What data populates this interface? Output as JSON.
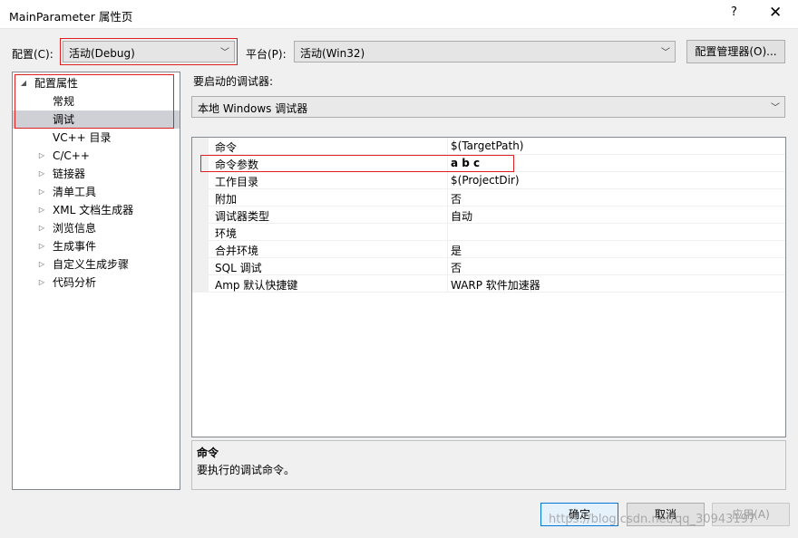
{
  "window": {
    "title": "MainParameter 属性页",
    "help_label": "?",
    "close_label": "✕"
  },
  "config": {
    "label": "配置(C):",
    "value": "活动(Debug)"
  },
  "platform": {
    "label": "平台(P):",
    "value": "活动(Win32)"
  },
  "config_manager_label": "配置管理器(O)...",
  "tree": {
    "root": "配置属性",
    "items": [
      {
        "label": "常规",
        "expandable": false
      },
      {
        "label": "调试",
        "expandable": false,
        "selected": true
      },
      {
        "label": "VC++ 目录",
        "expandable": false
      },
      {
        "label": "C/C++",
        "expandable": true
      },
      {
        "label": "链接器",
        "expandable": true
      },
      {
        "label": "清单工具",
        "expandable": true
      },
      {
        "label": "XML 文档生成器",
        "expandable": true
      },
      {
        "label": "浏览信息",
        "expandable": true
      },
      {
        "label": "生成事件",
        "expandable": true
      },
      {
        "label": "自定义生成步骤",
        "expandable": true
      },
      {
        "label": "代码分析",
        "expandable": true
      }
    ]
  },
  "debugger": {
    "label": "要启动的调试器:",
    "value": "本地 Windows 调试器"
  },
  "properties": [
    {
      "name": "命令",
      "value": "$(TargetPath)"
    },
    {
      "name": "命令参数",
      "value": "a b c",
      "bold": true
    },
    {
      "name": "工作目录",
      "value": "$(ProjectDir)"
    },
    {
      "name": "附加",
      "value": "否"
    },
    {
      "name": "调试器类型",
      "value": "自动"
    },
    {
      "name": "环境",
      "value": ""
    },
    {
      "name": "合并环境",
      "value": "是"
    },
    {
      "name": "SQL 调试",
      "value": "否"
    },
    {
      "name": "Amp 默认快捷键",
      "value": "WARP 软件加速器"
    }
  ],
  "description": {
    "title": "命令",
    "text": "要执行的调试命令。"
  },
  "buttons": {
    "ok": "确定",
    "cancel": "取消",
    "apply": "应用(A)"
  },
  "watermark": "https://blog.csdn.net/qq_30943197",
  "colors": {
    "highlight_box": "#e02020",
    "selection": "#cfcfd6",
    "focus_border": "#0078d7"
  }
}
